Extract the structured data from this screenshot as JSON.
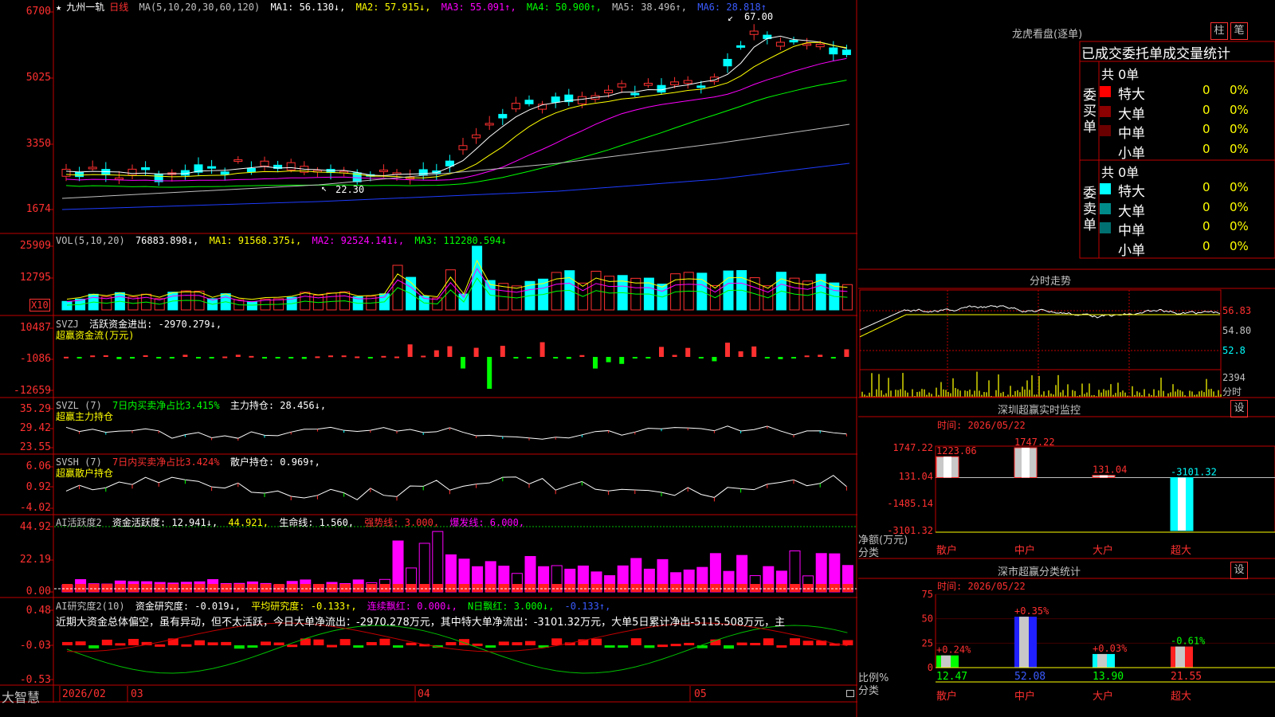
{
  "stock": {
    "star": "★",
    "name": "九州一轨",
    "period": "日线"
  },
  "main_chart": {
    "legend_ma": "MA(5,10,20,30,60,120)",
    "ma1": "MA1: 56.130↓,",
    "ma2": "MA2: 57.915↓,",
    "ma3": "MA3: 55.091↑,",
    "ma4": "MA4: 50.900↑,",
    "ma5": "MA5: 38.496↑,",
    "ma6": "MA6: 28.818↑",
    "y_ticks": [
      "6700",
      "5025",
      "3350",
      "1674"
    ],
    "high_label": "67.00",
    "low_label": "22.30",
    "colors": {
      "ma1": "#ffffff",
      "ma2": "#ffff00",
      "ma3": "#ff00ff",
      "ma4": "#00ff00",
      "ma5": "#c0c0c0",
      "ma6": "#1e3cff",
      "up": "#ff3030",
      "down": "#00ffff"
    }
  },
  "vol_panel": {
    "legend": "VOL(5,10,20)",
    "value": "76883.898↓,",
    "ma1": "MA1: 91568.375↓,",
    "ma2": "MA2: 92524.141↓,",
    "ma3": "MA3: 112280.594↓",
    "y_ticks": [
      "25909",
      "12795"
    ],
    "unit": "X10"
  },
  "svzj_panel": {
    "legend": "SVZJ",
    "label": "活跃资金进出: -2970.279↓,",
    "sub": "超赢资金流(万元)",
    "y_ticks": [
      "10487",
      "-1086",
      "-12659"
    ]
  },
  "svzl_panel": {
    "legend": "SVZL (7)",
    "ratio": "7日内买卖净占比3.415%",
    "hold": "主力持仓: 28.456↓,",
    "sub": "超赢主力持仓",
    "y_ticks": [
      "35.29",
      "29.42",
      "23.55"
    ]
  },
  "svsh_panel": {
    "legend": "SVSH (7)",
    "ratio": "7日内买卖净占比3.424%",
    "hold": "散户持仓: 0.969↑,",
    "sub": "超赢散户持仓",
    "y_ticks": [
      "6.06",
      "0.92",
      "-4.02"
    ]
  },
  "ai_active": {
    "legend": "AI活跃度2",
    "act": "资金活跃度: 12.941↓,",
    "v2": "44.921,",
    "life": "生命线: 1.560,",
    "strong": "强势线: 3.000,",
    "burst": "爆发线: 6.000,",
    "y_ticks": [
      "44.92",
      "22.19",
      "0.00"
    ]
  },
  "ai_research": {
    "legend": "AI研究度2(10)",
    "res": "资金研究度: -0.019↓,",
    "avg": "平均研究度: -0.133↑,",
    "cont": "连续飘红: 0.000↓,",
    "nday": "N日飘红: 3.000↓,",
    "last": "-0.133↑,",
    "comment": "近期大资金总体偏空，虽有异动，但不太活跃，今日大单净流出：-2970.278万元，其中特大单净流出：-3101.32万元，大单5日累计净出-5115.508万元，主",
    "y_ticks": [
      "0.48",
      "-0.03",
      "-0.53"
    ]
  },
  "x_axis": {
    "labels": [
      "2026/02",
      "03",
      "04",
      "05"
    ],
    "brand": "大智慧"
  },
  "dragon_tiger": {
    "title": "龙虎看盘(逐单)",
    "btn_col": "柱",
    "btn_pen": "笔",
    "header": "已成交委托单成交量统计",
    "buy": {
      "side": "委买单",
      "total": "共 0单",
      "rows": [
        {
          "label": "特大",
          "count": "0",
          "pct": "0%",
          "color": "#ff0000"
        },
        {
          "label": "大单",
          "count": "0",
          "pct": "0%",
          "color": "#8b0000"
        },
        {
          "label": "中单",
          "count": "0",
          "pct": "0%",
          "color": "#6b0000"
        },
        {
          "label": "小单",
          "count": "0",
          "pct": "0%",
          "color": "#000000"
        }
      ]
    },
    "sell": {
      "side": "委卖单",
      "total": "共 0单",
      "rows": [
        {
          "label": "特大",
          "count": "0",
          "pct": "0%",
          "color": "#00ffff"
        },
        {
          "label": "大单",
          "count": "0",
          "pct": "0%",
          "color": "#008b8b"
        },
        {
          "label": "中单",
          "count": "0",
          "pct": "0%",
          "color": "#007070"
        },
        {
          "label": "小单",
          "count": "0",
          "pct": "0%",
          "color": "#000000"
        }
      ]
    }
  },
  "intraday": {
    "title": "分时走势",
    "prices": [
      "56.83",
      "54.80",
      "52.8"
    ],
    "vol_top": "2394",
    "vol_unit": "分时"
  },
  "sz_monitor": {
    "title": "深圳超赢实时监控",
    "btn": "设",
    "time": "时间: 2026/05/22",
    "y_ticks": [
      "1747.22",
      "131.04",
      "-1485.14",
      "-3101.32"
    ],
    "ylabel": "净额(万元)",
    "xlabel": "分类",
    "chart_data": {
      "type": "bar",
      "categories": [
        "散户",
        "中户",
        "大户",
        "超大"
      ],
      "values": [
        1223.06,
        1747.22,
        131.04,
        -3101.32
      ],
      "labels": [
        "1223.06",
        "1747.22",
        "131.04",
        "-3101.32"
      ],
      "ylim": [
        -3101.32,
        1747.22
      ]
    }
  },
  "sz_class": {
    "title": "深市超赢分类统计",
    "btn": "设",
    "time": "时间: 2026/05/22",
    "y_ticks": [
      "75",
      "50",
      "25",
      "0"
    ],
    "ylabel": "比例%",
    "xlabel": "分类",
    "chart_data": {
      "type": "bar",
      "categories": [
        "散户",
        "中户",
        "大户",
        "超大"
      ],
      "values": [
        12.47,
        52.08,
        13.9,
        21.55
      ],
      "changes": [
        "+0.24%",
        "+0.35%",
        "+0.03%",
        "-0.61%"
      ],
      "ylim": [
        0,
        75
      ]
    }
  }
}
